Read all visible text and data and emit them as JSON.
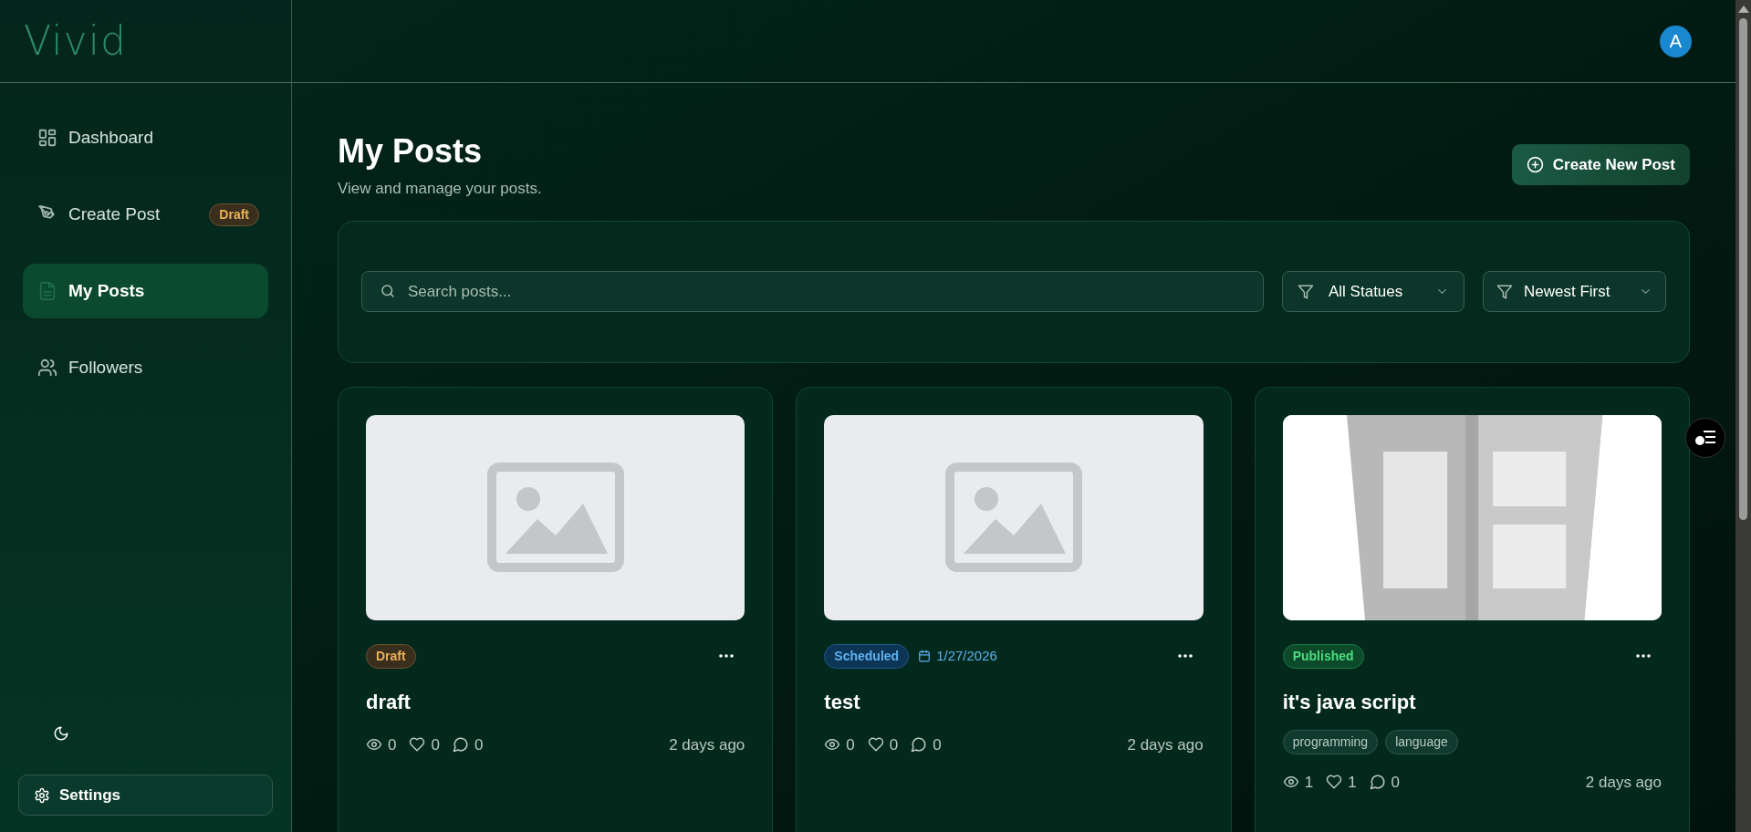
{
  "logo": "Vivid",
  "sidebar": {
    "items": [
      {
        "label": "Dashboard",
        "selected": false
      },
      {
        "label": "Create Post",
        "selected": false,
        "badge": "Draft"
      },
      {
        "label": "My Posts",
        "selected": true
      },
      {
        "label": "Followers",
        "selected": false
      }
    ],
    "settings": "Settings"
  },
  "header": {
    "avatar": "A"
  },
  "page": {
    "title": "My Posts",
    "subtitle": "View and manage your posts.",
    "create_button": "Create New Post"
  },
  "filters": {
    "search_placeholder": "Search posts...",
    "status": "All Statues",
    "sort": "Newest First"
  },
  "posts": [
    {
      "image": {
        "kind": "placeholder"
      },
      "kind": "draft",
      "status_label": "Draft",
      "title": "draft",
      "views": "0",
      "likes": "0",
      "comments": "0",
      "time": "2 days ago"
    },
    {
      "image": {
        "kind": "placeholder"
      },
      "kind": "scheduled",
      "status_label": "Scheduled",
      "date": "1/27/2026",
      "title": "test",
      "views": "0",
      "likes": "0",
      "comments": "0",
      "time": "2 days ago"
    },
    {
      "image": {
        "kind": "picture"
      },
      "kind": "published",
      "status_label": "Published",
      "title": "it's java script",
      "tags": [
        "programming",
        "language"
      ],
      "views": "1",
      "likes": "1",
      "comments": "0",
      "time": "2 days ago"
    }
  ]
}
